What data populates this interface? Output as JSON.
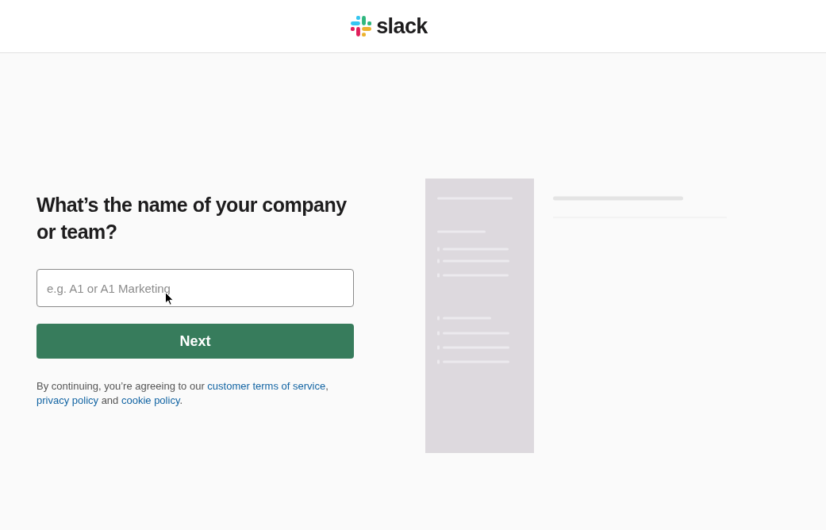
{
  "header": {
    "logo": {
      "text": "slack"
    }
  },
  "form": {
    "heading": "What’s the name of your company or team?",
    "name_field": {
      "placeholder": "e.g. A1 or A1 Marketing"
    },
    "submit_button": {
      "label": "Next"
    },
    "legal_notice": [
      {
        "kind": "text",
        "text": "By continuing, you’re agreeing to our "
      },
      {
        "kind": "link",
        "text": "customer terms of service"
      },
      {
        "kind": "text",
        "text": ", "
      },
      {
        "kind": "link",
        "text": "privacy policy"
      },
      {
        "kind": "text",
        "text": " and "
      },
      {
        "kind": "link",
        "text": "cookie policy"
      },
      {
        "kind": "text",
        "text": "."
      }
    ]
  }
}
